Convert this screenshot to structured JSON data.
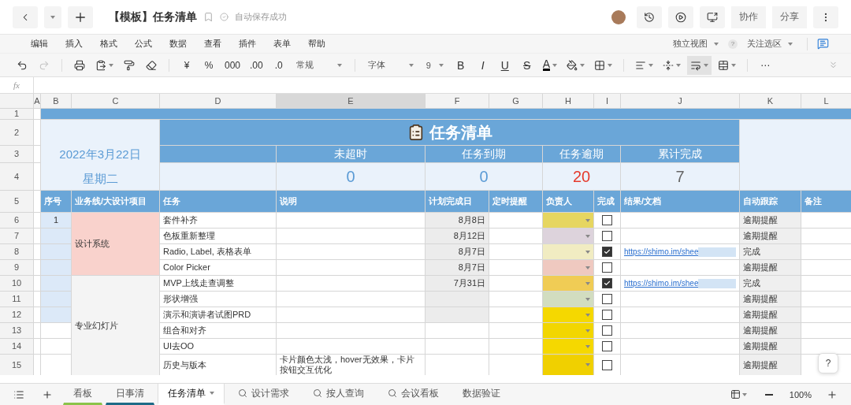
{
  "top_bar": {
    "title": "【模板】任务清单",
    "save_status": "自动保存成功",
    "buttons": [
      "协作",
      "分享"
    ]
  },
  "menu": {
    "items": [
      "编辑",
      "插入",
      "格式",
      "公式",
      "数据",
      "查看",
      "插件",
      "表单",
      "帮助"
    ],
    "view": "独立视图",
    "help": "?",
    "follow": "关注选区"
  },
  "toolbar": {
    "redo_disabled": true,
    "currency": "¥",
    "percent": "%",
    "thousands": "000",
    "add_decimal": ".00",
    "remove_decimal": ".0",
    "number_format": "常规",
    "font": "字体",
    "font_size": "9",
    "bold": "B",
    "italic": "I",
    "underline": "U",
    "strikethrough": "S",
    "font_color": "A",
    "wrap_active": true,
    "more": "⋯"
  },
  "formula_bar": {
    "label": "fx"
  },
  "columns": [
    {
      "label": "A",
      "selected": false
    },
    {
      "label": "B",
      "selected": false
    },
    {
      "label": "C",
      "selected": false
    },
    {
      "label": "D",
      "selected": false
    },
    {
      "label": "E",
      "selected": true
    },
    {
      "label": "F",
      "selected": false
    },
    {
      "label": "G",
      "selected": false
    },
    {
      "label": "H",
      "selected": false
    },
    {
      "label": "I",
      "selected": false
    },
    {
      "label": "J",
      "selected": false
    },
    {
      "label": "K",
      "selected": false
    },
    {
      "label": "L",
      "selected": false
    }
  ],
  "row_numbers": [
    "1",
    "2",
    "3",
    "4",
    "5",
    "6",
    "7",
    "8",
    "9",
    "10",
    "11",
    "12",
    "13",
    "14",
    "15"
  ],
  "sheet": {
    "title": "任务清单",
    "date": "2022年3月22日",
    "weekday": "星期二",
    "stats": [
      {
        "label": "未超时",
        "value": "0",
        "color": "#5b9bd5"
      },
      {
        "label": "任务到期",
        "value": "0",
        "color": "#5b9bd5"
      },
      {
        "label": "任务逾期",
        "value": "20",
        "color": "#e53a2c"
      },
      {
        "label": "累计完成",
        "value": "7",
        "color": "#666666"
      }
    ],
    "headers": [
      "序号",
      "业务线/大设计项目",
      "任务",
      "说明",
      "计划完成日",
      "定时提醒",
      "负责人",
      "完成",
      "结果/文档",
      "自动跟踪",
      "备注"
    ],
    "groups": [
      {
        "name": "设计系统",
        "color": "#f9d2cc",
        "tasks": [
          {
            "seq": "1",
            "name": "套件补齐",
            "due": "8月8日",
            "color": "#e6d660",
            "done": false,
            "tracking": "逾期提醒",
            "shaded": true
          },
          {
            "name": "色板重新整理",
            "due": "8月12日",
            "color": "#ddd3dc",
            "done": false,
            "tracking": "逾期提醒",
            "shaded": true
          },
          {
            "name": "Radio, Label, 表格表单",
            "due": "8月7日",
            "color": "#f1ecc2",
            "done": true,
            "link": "https://shimo.im/shee",
            "tracking": "完成",
            "shaded": true
          },
          {
            "name": "Color Picker",
            "due": "8月7日",
            "color": "#efc9c0",
            "done": false,
            "tracking": "逾期提醒",
            "shaded": true
          }
        ]
      },
      {
        "name": "专业幻灯片",
        "color": "#f4f4f4",
        "tasks": [
          {
            "name": "MVP上线走查调整",
            "due": "7月31日",
            "color": "#f0cc55",
            "done": true,
            "link": "https://shimo.im/shee",
            "tracking": "完成",
            "shaded": true
          },
          {
            "name": "形状增强",
            "color": "#d2ddc0",
            "done": false,
            "tracking": "逾期提醒",
            "shaded": true
          },
          {
            "name": "演示和演讲者试图PRD",
            "color": "#f5d800",
            "done": false,
            "tracking": "逾期提醒",
            "shaded": true
          },
          {
            "name": "组合和对齐",
            "color": "#f2d600",
            "done": false,
            "tracking": "逾期提醒",
            "shaded": false
          },
          {
            "name": "UI去OO",
            "color": "#f5d800",
            "done": false,
            "tracking": "逾期提醒",
            "shaded": false
          },
          {
            "name": "历史与版本",
            "note": "卡片颜色太浅，hover无效果，卡片按钮交互优化",
            "color": "#f0d000",
            "done": false,
            "tracking": "逾期提醒",
            "shaded": false
          }
        ]
      }
    ]
  },
  "help_button": "?",
  "sheet_tabs": [
    {
      "label": "看板",
      "selected": false,
      "kind": "plain",
      "color": "#8bc34a"
    },
    {
      "label": "日事清",
      "selected": false,
      "kind": "plain",
      "color": "#1e6b87"
    },
    {
      "label": "任务清单",
      "selected": true,
      "kind": "menu"
    },
    {
      "label": "设计需求",
      "selected": false,
      "kind": "search"
    },
    {
      "label": "按人查询",
      "selected": false,
      "kind": "search"
    },
    {
      "label": "会议看板",
      "selected": false,
      "kind": "search"
    },
    {
      "label": "数据验证",
      "selected": false,
      "kind": "plain"
    }
  ],
  "zoom": "100%"
}
